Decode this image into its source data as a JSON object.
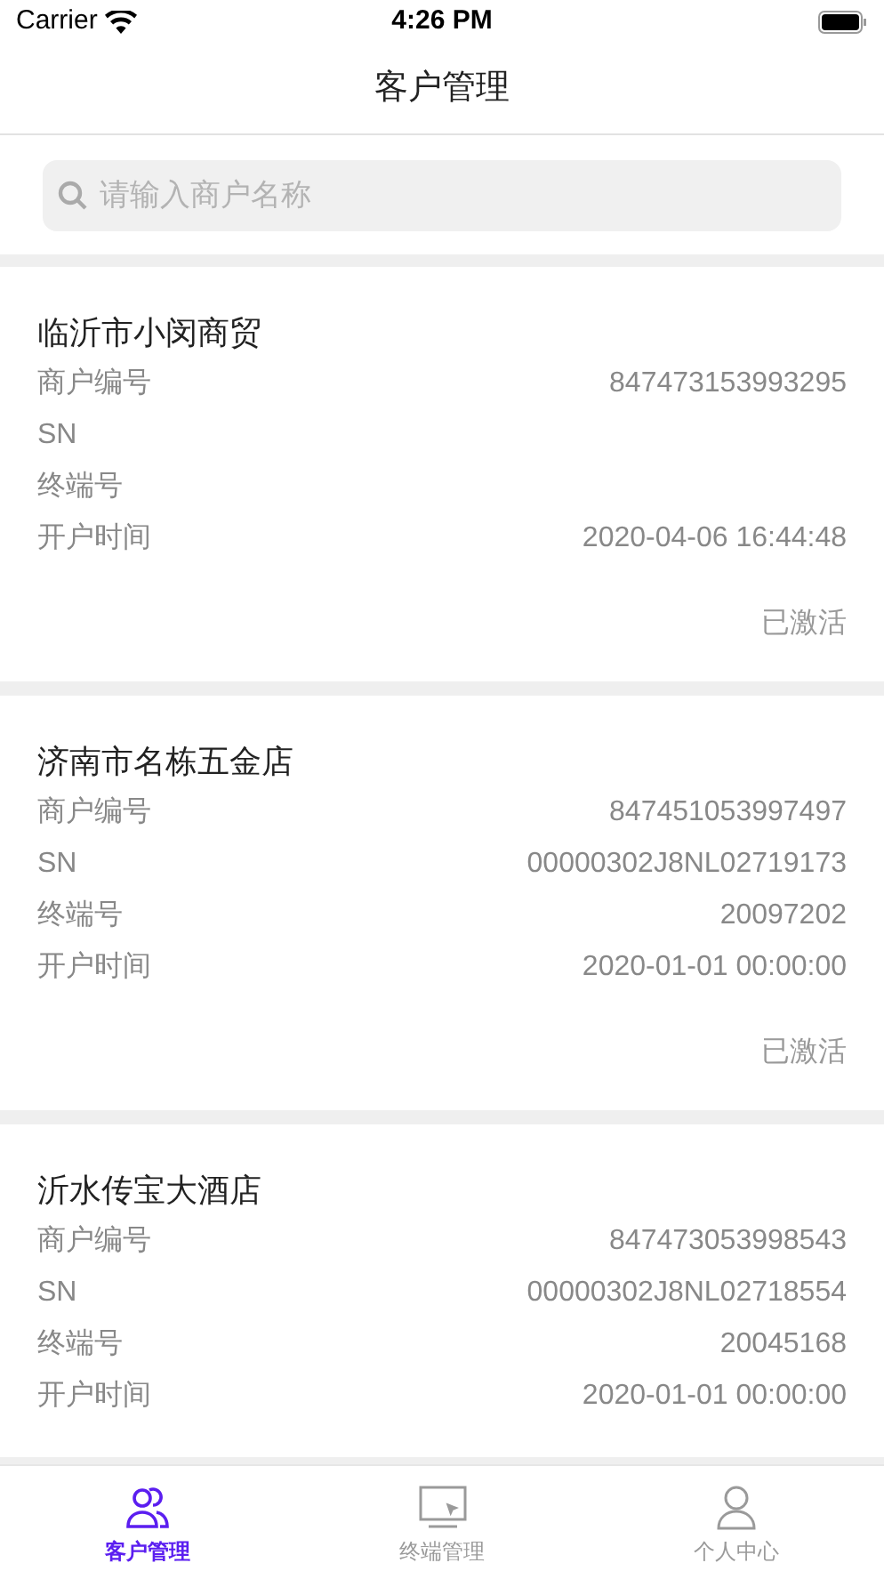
{
  "status_bar": {
    "carrier": "Carrier",
    "time": "4:26 PM"
  },
  "nav": {
    "title": "客户管理"
  },
  "search": {
    "placeholder": "请输入商户名称"
  },
  "customers": [
    {
      "name": "临沂市小闵商贸",
      "fields": [
        {
          "label": "商户编号",
          "value": "847473153993295"
        },
        {
          "label": "SN"
        },
        {
          "label": "终端号"
        },
        {
          "label": "开户时间",
          "value": "2020-04-06 16:44:48"
        }
      ],
      "status": "已激活"
    },
    {
      "name": "济南市名栋五金店",
      "fields": [
        {
          "label": "商户编号",
          "value": "847451053997497"
        },
        {
          "label": "SN",
          "value": "00000302J8NL02719173"
        },
        {
          "label": "终端号",
          "value": "20097202"
        },
        {
          "label": "开户时间",
          "value": "2020-01-01 00:00:00"
        }
      ],
      "status": "已激活"
    },
    {
      "name": "沂水传宝大酒店",
      "fields": [
        {
          "label": "商户编号",
          "value": "847473053998543"
        },
        {
          "label": "SN",
          "value": "00000302J8NL02718554"
        },
        {
          "label": "终端号",
          "value": "20045168"
        },
        {
          "label": "开户时间",
          "value": "2020-01-01 00:00:00"
        }
      ]
    }
  ],
  "tabs": [
    {
      "label": "客户管理",
      "kind": "people",
      "selected": true
    },
    {
      "label": "终端管理",
      "kind": "monitor",
      "selected": false
    },
    {
      "label": "个人中心",
      "kind": "person",
      "selected": false
    }
  ]
}
